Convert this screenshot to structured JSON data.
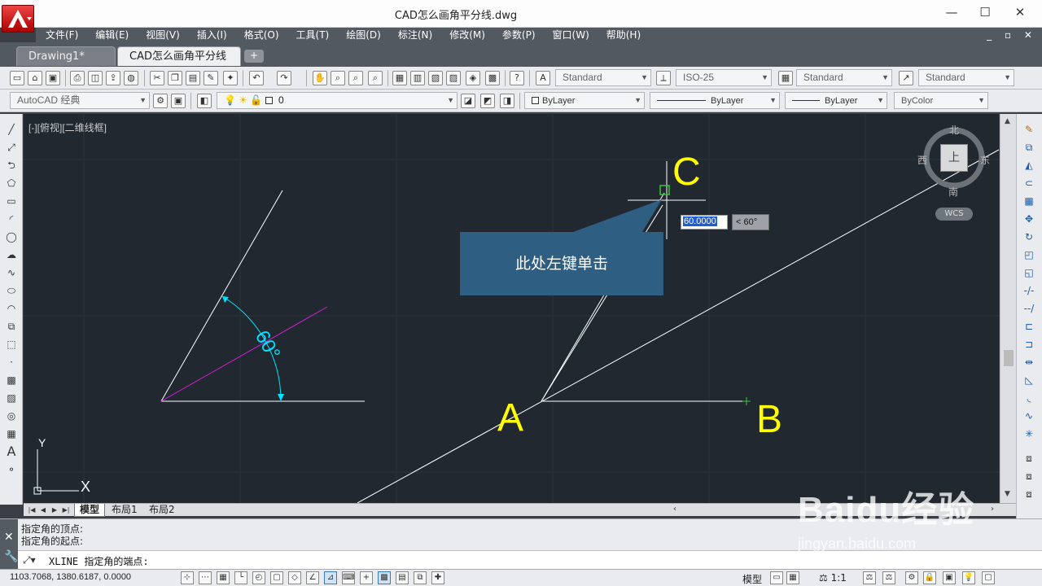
{
  "window": {
    "title": "CAD怎么画角平分线.dwg",
    "minimize": "—",
    "maximize": "☐",
    "close": "✕"
  },
  "menu": {
    "items": [
      "文件(F)",
      "编辑(E)",
      "视图(V)",
      "插入(I)",
      "格式(O)",
      "工具(T)",
      "绘图(D)",
      "标注(N)",
      "修改(M)",
      "参数(P)",
      "窗口(W)",
      "帮助(H)"
    ],
    "window_controls": "_ ▫ ✕"
  },
  "tabs": {
    "items": [
      {
        "label": "Drawing1*"
      },
      {
        "label": "CAD怎么画角平分线",
        "close": "✕"
      }
    ],
    "new_tab": "+"
  },
  "toolbar1": {
    "text_style": "Standard",
    "dim_style": "ISO-25",
    "table_style": "Standard",
    "multileader_style": "Standard"
  },
  "toolbar2": {
    "workspace": "AutoCAD 经典",
    "layer": "0",
    "color": "ByLayer",
    "linetype": "ByLayer",
    "lineweight": "ByLayer",
    "plotstyle": "ByColor"
  },
  "viewport": {
    "label": "[-][俯视][二维线框]",
    "angle_text": "60°",
    "point_a": "A",
    "point_b": "B",
    "point_c": "C",
    "callout": "此处左键单击",
    "dyn_input_value": "60.0000",
    "dyn_angle": "< 60°",
    "ucs_y": "Y",
    "ucs_x": "X"
  },
  "viewcube": {
    "north": "北",
    "south": "南",
    "east": "东",
    "west": "西",
    "face": "上",
    "wcs": "WCS"
  },
  "layout_tabs": {
    "items": [
      "模型",
      "布局1",
      "布局2"
    ]
  },
  "command": {
    "history": [
      "指定角的顶点:",
      "指定角的起点:"
    ],
    "prompt": "XLINE 指定角的端点:"
  },
  "status": {
    "coords": "1103.7068, 1380.6187, 0.0000",
    "model": "模型",
    "scale": "1:1"
  },
  "watermark": {
    "logo": "Baidu经验",
    "url": "jingyan.baidu.com"
  },
  "colors": {
    "canvas": "#212830",
    "annotation": "#ffff00",
    "bisector": "#d020d0",
    "dimension": "#00e5ff",
    "callout": "#2e5e82"
  }
}
